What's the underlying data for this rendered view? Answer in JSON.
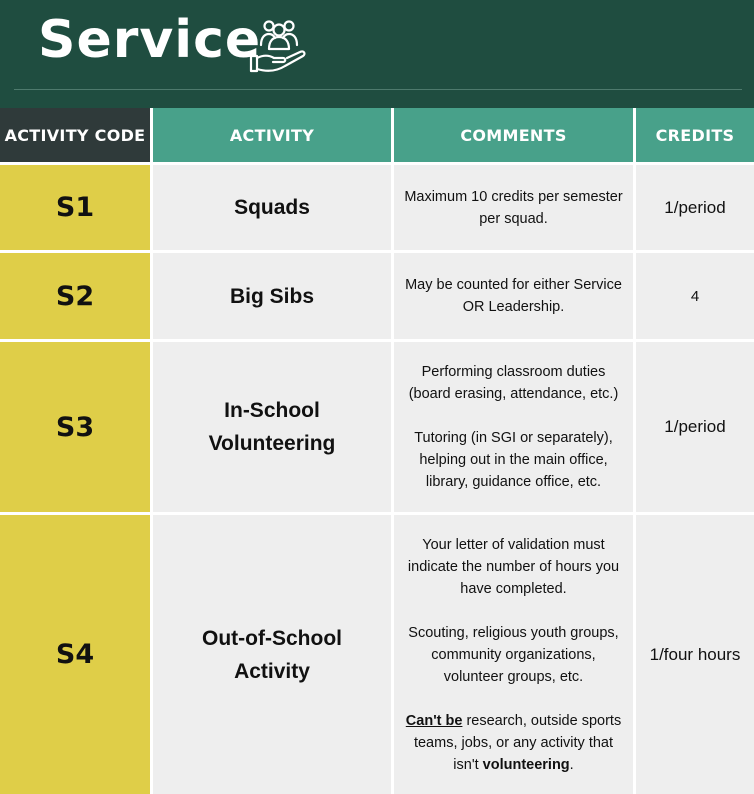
{
  "header": {
    "title": "Service",
    "icon": "hand-with-group-icon"
  },
  "table": {
    "columns": [
      "ACTIVITY CODE",
      "ACTIVITY",
      "COMMENTS",
      "CREDITS"
    ],
    "rows": [
      {
        "code": "S1",
        "activity": [
          "Squads"
        ],
        "comments": [
          "Maximum 10 credits per semester per squad."
        ],
        "credits": "1/period"
      },
      {
        "code": "S2",
        "activity": [
          "Big Sibs"
        ],
        "comments": [
          "May be counted for either Service OR Leadership."
        ],
        "credits": "4"
      },
      {
        "code": "S3",
        "activity": [
          "In-School",
          "Volunteering"
        ],
        "comments": [
          "Performing classroom duties (board erasing, attendance, etc.)",
          "Tutoring (in SGI or separately), helping out in the main office, library, guidance office, etc."
        ],
        "credits": "1/period"
      },
      {
        "code": "S4",
        "activity": [
          "Out-of-School",
          "Activity"
        ],
        "comments": [
          "Your letter of validation must indicate the number of hours you have completed.",
          "Scouting, religious youth groups, community organizations, volunteer groups, etc."
        ],
        "comment3": {
          "emph": "Can't be",
          "mid": " research, outside sports teams, jobs, or any activity that isn't ",
          "bold": "volunteering",
          "end": "."
        },
        "credits": "1/four hours"
      }
    ]
  },
  "colors": {
    "header_bg": "#1f4d40",
    "code_header_bg": "#2f3a3a",
    "teal_header_bg": "#48a18a",
    "code_cell_bg": "#dfce48",
    "body_cell_bg": "#eeeeee"
  }
}
